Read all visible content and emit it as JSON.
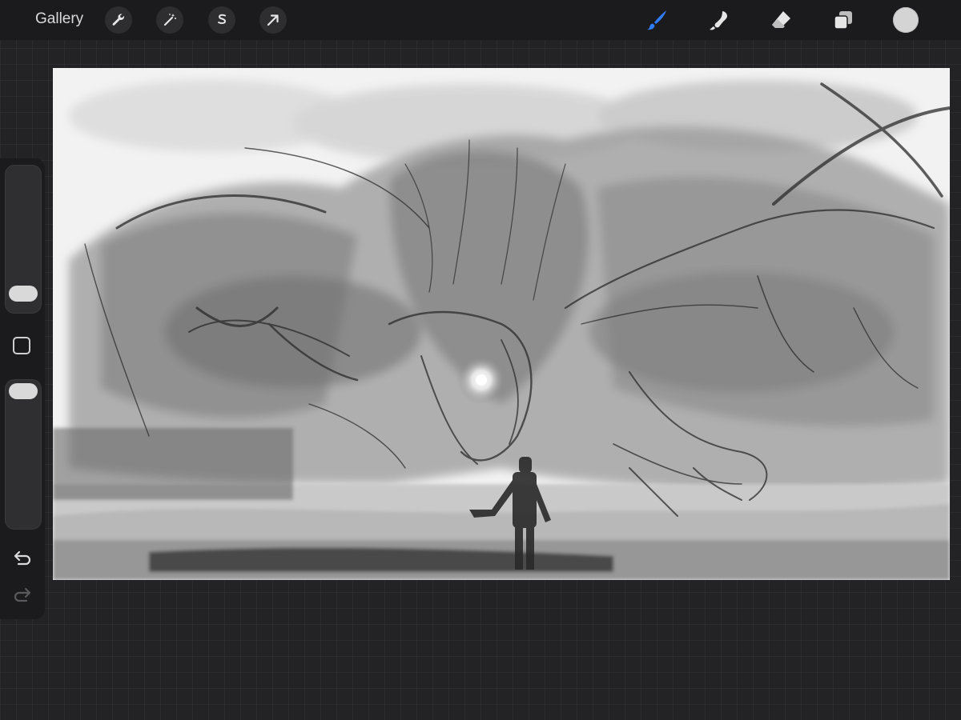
{
  "toolbar": {
    "gallery_label": "Gallery",
    "left_tools": [
      "wrench-icon",
      "magic-wand-icon",
      "selection-s-icon",
      "transform-arrow-icon"
    ],
    "right_tools": [
      "brush-icon",
      "smudge-icon",
      "eraser-icon",
      "layers-icon"
    ],
    "active_tool": "brush-icon",
    "accent_color": "#2f7cf6",
    "current_color": "#d4d4d4"
  },
  "sidebar": {
    "brush_size_level": 0.1,
    "opacity_level": 1.0,
    "undo_icon": "undo-icon",
    "redo_icon": "redo-icon"
  },
  "canvas": {
    "artwork": "grayscale-sketch"
  }
}
